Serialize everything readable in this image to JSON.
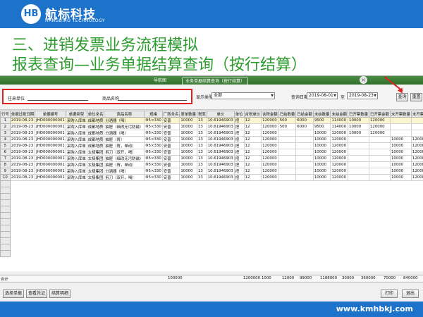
{
  "brand": {
    "logo_text": "HB",
    "name_cn": "航标科技",
    "name_en": "HANGBIAO TECHNOLOGY",
    "color": "#1d73c9"
  },
  "slide": {
    "title_line1": "三、进销发票业务流程模拟",
    "title_line2": "报表查询—业务单据结算查询（按行结算）",
    "title_color": "#2e9b2e"
  },
  "app": {
    "tabs": [
      "导航图",
      "业务单据结算查询（按行结算）"
    ],
    "close_icon": "×",
    "filter": {
      "partner_label": "往来单位",
      "product_label": "商品名称",
      "display_type_label": "显示类型",
      "display_type_value": "全部",
      "date_label": "查询日期",
      "date_from": "2019-08-01",
      "to_label": "至",
      "date_to": "2019-08-23",
      "query_button": "查询",
      "reset_button": "重置"
    },
    "columns": [
      "行号",
      "单据过账日期",
      "单据编号",
      "单据类型",
      "单位全名",
      "商品名称",
      "规格",
      "厂商全名",
      "原单数量",
      "税率",
      "单价",
      "单位",
      "含税单价",
      "含税金额",
      "已结数量",
      "已结金额",
      "未结数量",
      "未结金额",
      "已开票数量",
      "已开票金额",
      "未开票数量",
      "未开票金额"
    ],
    "rows": [
      [
        "1",
        "2019-08-23",
        "JHD000000001",
        "采购入库单",
        "成都地质",
        "分酒器（喝）",
        "Φ5×330",
        "安普",
        "10000",
        "13",
        "10.61946903",
        "把",
        "12",
        "120000",
        "500",
        "6000",
        "9500",
        "114000",
        "10000",
        "120000",
        "",
        ""
      ],
      [
        "2",
        "2019-08-23",
        "JHD000000001",
        "采购入库单",
        "成都地质",
        "抽屉（细改无污防磁）",
        "Φ5×330",
        "安普",
        "10000",
        "13",
        "10.61946903",
        "把",
        "12",
        "120000",
        "500",
        "6000",
        "9500",
        "114000",
        "10000",
        "120000",
        "",
        ""
      ],
      [
        "3",
        "2019-08-23",
        "JHD000000001",
        "采购入库单",
        "成都地质",
        "分酒器（喝）",
        "Φ5×330",
        "安普",
        "10000",
        "13",
        "10.61946903",
        "把",
        "12",
        "120000",
        "",
        "",
        "10000",
        "120000",
        "10000",
        "120000",
        "",
        ""
      ],
      [
        "4",
        "2019-08-23",
        "JHD000000001",
        "采购入库单",
        "成都地质",
        "抽屉（胃）",
        "Φ5×330",
        "安普",
        "10000",
        "13",
        "10.61946903",
        "把",
        "12",
        "120000",
        "",
        "",
        "10000",
        "120000",
        "",
        "",
        "10000",
        "120000"
      ],
      [
        "5",
        "2019-08-23",
        "JHD000000001",
        "采购入库单",
        "成都地质",
        "抽屉（胃，单动）",
        "Φ5×330",
        "安普",
        "10000",
        "13",
        "10.61946903",
        "把",
        "12",
        "120000",
        "",
        "",
        "10000",
        "120000",
        "",
        "",
        "10000",
        "120000"
      ],
      [
        "6",
        "2019-08-23",
        "JHD000000001",
        "采购入库单",
        "太极集团",
        "剪刀（双开，喝）",
        "Φ5×330",
        "安普",
        "10000",
        "13",
        "10.61946903",
        "把",
        "12",
        "120000",
        "",
        "",
        "10000",
        "120000",
        "",
        "",
        "10000",
        "120000"
      ],
      [
        "7",
        "2019-08-23",
        "JHD000000001",
        "采购入库单",
        "太极集团",
        "抽屉（细改无污防磁）",
        "Φ5×330",
        "安普",
        "10000",
        "13",
        "10.61946903",
        "把",
        "12",
        "120000",
        "",
        "",
        "10000",
        "120000",
        "",
        "",
        "10000",
        "120000"
      ],
      [
        "8",
        "2019-08-23",
        "JHD000000001",
        "采购入库单",
        "太极集团",
        "抽屉（胃，单动）",
        "Φ5×330",
        "安普",
        "10000",
        "13",
        "10.61946903",
        "把",
        "12",
        "120000",
        "",
        "",
        "10000",
        "120000",
        "",
        "",
        "10000",
        "120000"
      ],
      [
        "9",
        "2019-08-23",
        "JHD000000001",
        "采购入库单",
        "太极集团",
        "分酒器（喝）",
        "Φ5×330",
        "安普",
        "10000",
        "13",
        "10.61946903",
        "把",
        "12",
        "120000",
        "",
        "",
        "10000",
        "120000",
        "",
        "",
        "10000",
        "120000"
      ],
      [
        "10",
        "2019-08-23",
        "JHD000000001",
        "采购入库单",
        "太极集团",
        "剪刀（双开，喝）",
        "Φ5×330",
        "安普",
        "10000",
        "13",
        "10.61946903",
        "把",
        "12",
        "120000",
        "",
        "",
        "10000",
        "120000",
        "",
        "",
        "10000",
        "120000"
      ]
    ],
    "totals": {
      "label": "合计",
      "qty": "100000",
      "amount": "1200000",
      "settled_qty": "1000",
      "settled_amount": "12000",
      "unsettled_qty": "99000",
      "unsettled_amount": "1188000",
      "invoiced_qty": "30000",
      "invoiced_amount": "360000",
      "uninvoiced_qty": "70000",
      "uninvoiced_amount": "840000"
    },
    "buttons": {
      "select_doc": "选择单据",
      "view_voucher": "查看凭证",
      "settle_detail": "结算明细",
      "print": "打印",
      "exit": "退出"
    }
  },
  "footer": {
    "url": "www.kmhbkj.com"
  }
}
